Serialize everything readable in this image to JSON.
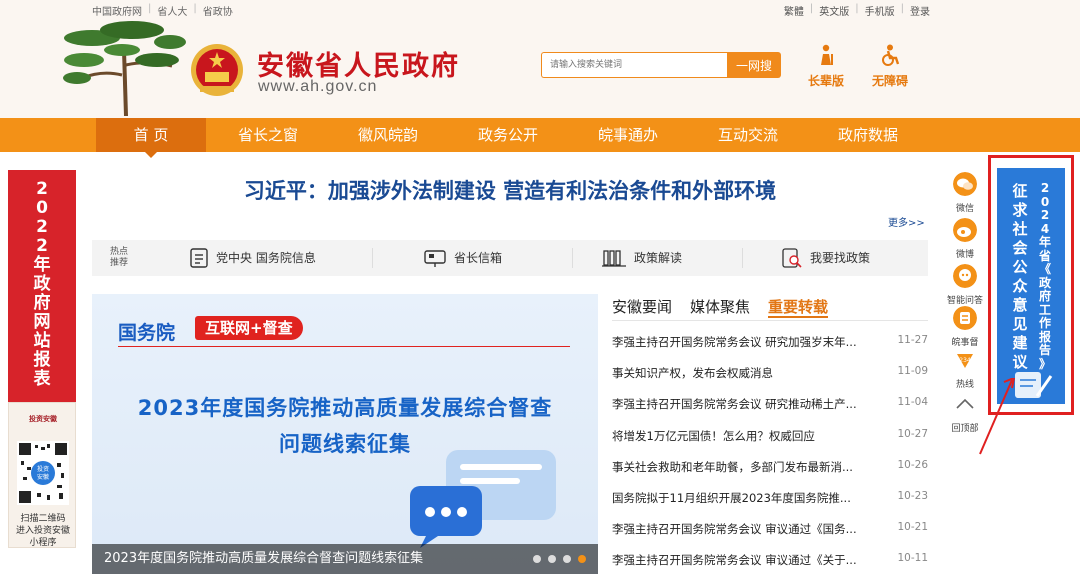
{
  "top_links_left": [
    "中国政府网",
    "省人大",
    "省政协"
  ],
  "top_links_right": [
    "繁體",
    "英文版",
    "手机版",
    "登录"
  ],
  "header": {
    "site_title": "安徽省人民政府",
    "site_url": "www.ah.gov.cn",
    "search_placeholder": "请输入搜索关键词",
    "search_button": "一网搜",
    "elder_version": "长辈版",
    "accessible_version": "无障碍"
  },
  "nav": [
    "首 页",
    "省长之窗",
    "徽风皖韵",
    "政务公开",
    "皖事通办",
    "互动交流",
    "政府数据"
  ],
  "left_banner": {
    "text": [
      "2",
      "0",
      "2",
      "2",
      "年",
      "政",
      "府",
      "网",
      "站",
      "报",
      "表"
    ]
  },
  "qr_panel": {
    "logo_text": "投资安徽",
    "caption": [
      "扫描二维码",
      "进入投资安徽",
      "小程序"
    ]
  },
  "headline": {
    "text": "习近平：加强涉外法制建设 营造有利法治条件和外部环境",
    "more": "更多>>"
  },
  "quickbar": {
    "tag": [
      "热点",
      "推荐"
    ],
    "items": [
      "党中央 国务院信息",
      "省长信箱",
      "政策解读",
      "我要找政策"
    ]
  },
  "slide": {
    "brand": "国务院",
    "tag": "互联网+督查",
    "title_line1": "2023年度国务院推动高质量发展综合督查",
    "title_line2": "问题线索征集",
    "caption": "2023年度国务院推动高质量发展综合督查问题线索征集"
  },
  "news_tabs": [
    "安徽要闻",
    "媒体聚焦",
    "重要转载"
  ],
  "news_active_tab": 2,
  "news": [
    {
      "title": "李强主持召开国务院常务会议 研究加强岁末年...",
      "date": "11-27"
    },
    {
      "title": "事关知识产权，发布会权威消息",
      "date": "11-09"
    },
    {
      "title": "李强主持召开国务院常务会议 研究推动稀土产...",
      "date": "11-04"
    },
    {
      "title": "将增发1万亿元国债！怎么用？权威回应",
      "date": "10-27"
    },
    {
      "title": "事关社会救助和老年助餐，多部门发布最新消...",
      "date": "10-26"
    },
    {
      "title": "国务院拟于11月组织开展2023年度国务院推...",
      "date": "10-23"
    },
    {
      "title": "李强主持召开国务院常务会议 审议通过《国务...",
      "date": "10-21"
    },
    {
      "title": "李强主持召开国务院常务会议 审议通过《关于...",
      "date": "10-11"
    }
  ],
  "side_tools": [
    "微信",
    "微博",
    "智能问答",
    "皖事督",
    "热线",
    "回顶部"
  ],
  "right_banner": {
    "line1": [
      "2",
      "0",
      "2",
      "4",
      "年",
      "省",
      "《",
      "政",
      "府",
      "工",
      "作",
      "报",
      "告",
      "》"
    ],
    "line2": [
      "征",
      "求",
      "社",
      "会",
      "公",
      "众",
      "意",
      "见",
      "建",
      "议"
    ]
  },
  "colors": {
    "nav_orange": "#f39117",
    "nav_active": "#dc6e0e",
    "title_red": "#c8161d",
    "headline_blue": "#1a4a93",
    "banner_red": "#d7232a",
    "banner_blue": "#2a7ad8"
  }
}
